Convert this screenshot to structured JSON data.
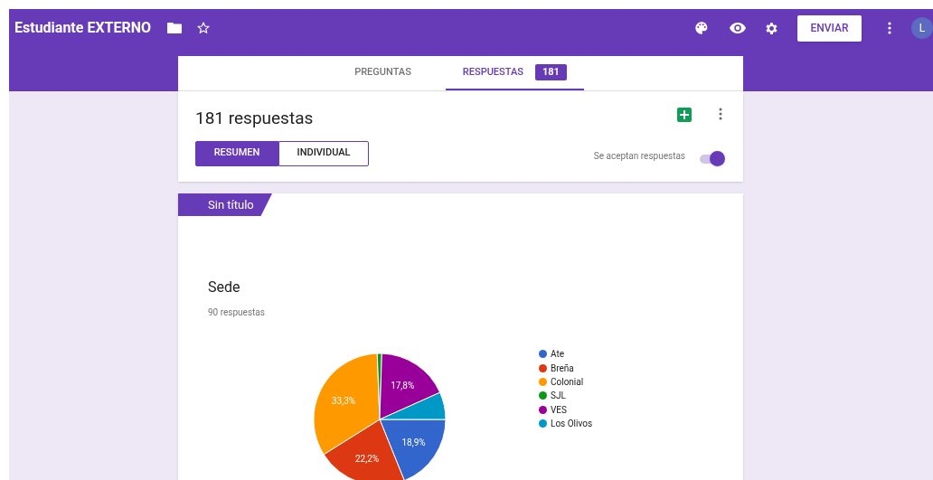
{
  "header": {
    "title": "Estudiante EXTERNO",
    "send_button": "ENVIAR",
    "avatar": "L"
  },
  "tabs": [
    {
      "label": "PREGUNTAS",
      "selected": false
    },
    {
      "label": "RESPUESTAS",
      "selected": true,
      "badge": "181"
    }
  ],
  "summary": {
    "title": "181 respuestas",
    "views": [
      {
        "label": "RESUMEN",
        "selected": true
      },
      {
        "label": "INDIVIDUAL",
        "selected": false
      }
    ],
    "accepting_label": "Se aceptan respuestas",
    "accepting": true
  },
  "section": {
    "tag": "Sin título"
  },
  "question": {
    "title": "Sede",
    "count": "90 respuestas",
    "chart_data": {
      "type": "pie",
      "categories": [
        "Ate",
        "Breña",
        "Colonial",
        "SJL",
        "VES",
        "Los Olivos"
      ],
      "legend": "right",
      "series": [
        {
          "colors": [
            "#3366cc",
            "#dc3912",
            "#ff9900",
            "#109618",
            "#990099",
            "#0099c6"
          ],
          "values": [
            18.9,
            22.2,
            33.3,
            1.1,
            17.8,
            6.7
          ]
        }
      ],
      "value_labels": [
        "18,9%",
        "22,2%",
        "33,3%",
        null,
        "17,8%",
        null
      ]
    }
  }
}
